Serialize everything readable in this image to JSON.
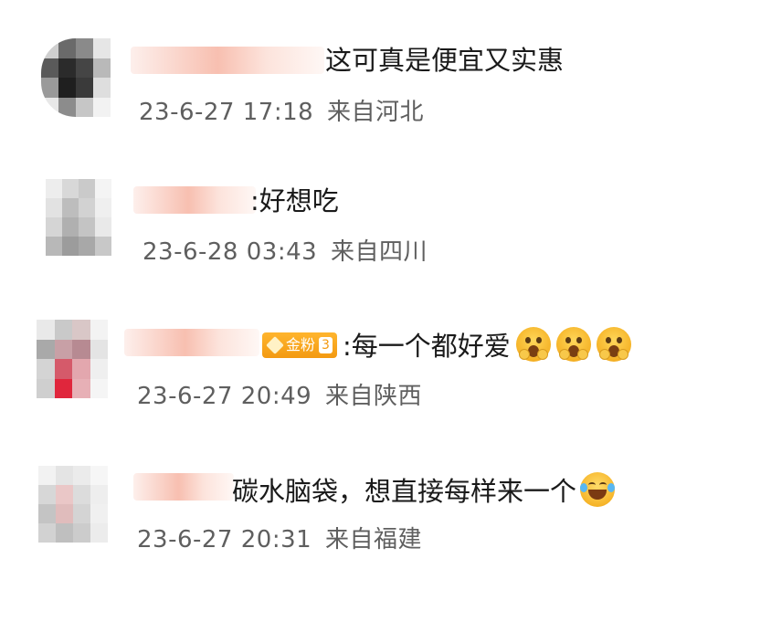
{
  "comments": [
    {
      "text": "这可真是便宜又实惠",
      "time": "23-6-27 17:18",
      "location": "来自河北"
    },
    {
      "text": ":好想吃",
      "time": "23-6-28 03:43",
      "location": "来自四川"
    },
    {
      "text": ":每一个都好爱",
      "time": "23-6-27 20:49",
      "location": "来自陕西",
      "badge": {
        "label": "金粉",
        "level": "3"
      },
      "emoji": [
        "face-with-open-mouth-icon",
        "face-with-open-mouth-icon",
        "face-with-open-mouth-icon"
      ]
    },
    {
      "text": "碳水脑袋，想直接每样来一个",
      "time": "23-6-27 20:31",
      "location": "来自福建",
      "emoji": [
        "laughing-with-tears-icon"
      ]
    }
  ],
  "colors": {
    "text": "#1a1a1a",
    "meta": "#5f5f5f",
    "badge": "#f39a12"
  }
}
